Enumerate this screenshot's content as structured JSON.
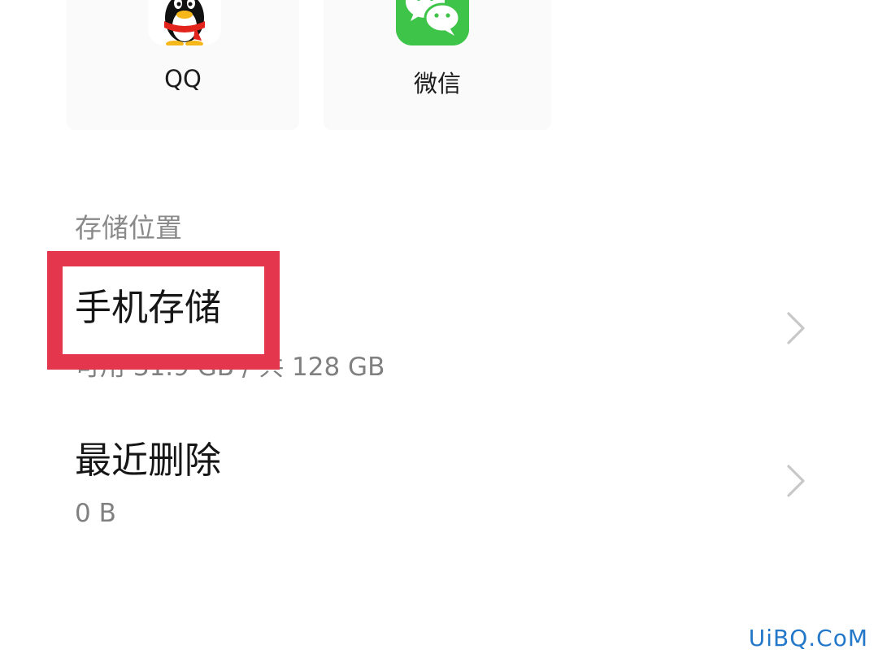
{
  "apps": [
    {
      "label": "QQ",
      "icon": "qq-penguin-icon"
    },
    {
      "label": "微信",
      "icon": "wechat-icon"
    }
  ],
  "storage_section": {
    "header": "存储位置",
    "items": [
      {
        "title": "手机存储",
        "subtitle": "可用 31.9 GB / 共 128 GB",
        "icon": "chevron-right-icon"
      },
      {
        "title": "最近删除",
        "subtitle": "0 B",
        "icon": "chevron-right-icon"
      }
    ]
  },
  "annotation": {
    "color": "#e4374e"
  },
  "watermark": "UiBQ.CoM",
  "colors": {
    "wechat_green": "#3fc44a",
    "title_text": "#161616",
    "secondary_text": "#808080",
    "watermark": "#2478c9"
  }
}
